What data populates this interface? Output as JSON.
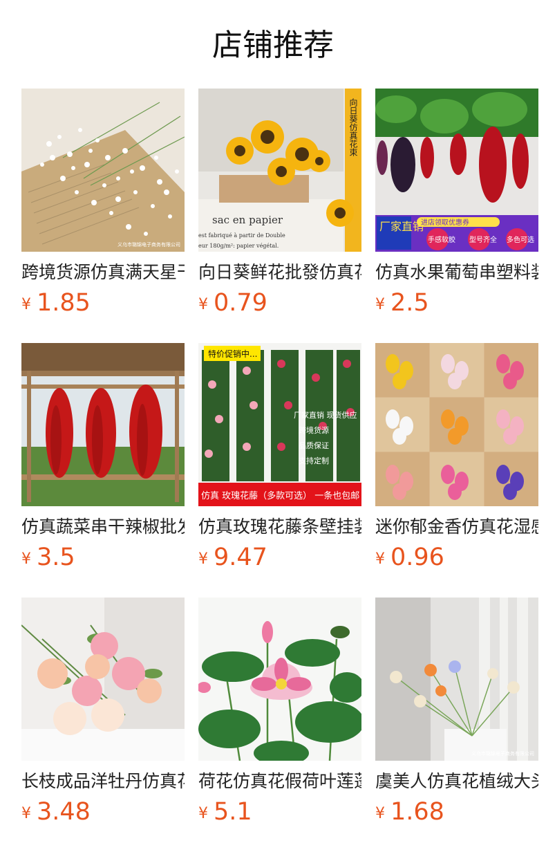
{
  "header": {
    "title": "店铺推荐"
  },
  "products": [
    {
      "name": "跨境货源仿真满天星干花批发",
      "currency": "¥",
      "price": "1.85",
      "watermark": "义乌市璐锦电子商务有限公司"
    },
    {
      "name": "向日葵鲜花批發仿真花束",
      "currency": "¥",
      "price": "0.79",
      "overlay": {
        "vertical": "向日葵仿真花束",
        "paper_line1": "sac en papier",
        "paper_line2": "est fabriqué à partir de Double",
        "paper_line3": "eur 180g/m²: papier végétal."
      }
    },
    {
      "name": "仿真水果葡萄串塑料装饰",
      "currency": "¥",
      "price": "2.5",
      "overlay": {
        "badge": "厂家直销",
        "coupon": "进店领取优惠券",
        "tag1": "手感软胶",
        "tag2": "型号齐全",
        "tag3": "多色可选"
      }
    },
    {
      "name": "仿真蔬菜串干辣椒批发装饰",
      "currency": "¥",
      "price": "3.5"
    },
    {
      "name": "仿真玫瑰花藤条壁挂装饰",
      "currency": "¥",
      "price": "9.47",
      "overlay": {
        "promo": "特价促销中...",
        "l1": "厂家直销 现货供应",
        "l2": "跨境货源",
        "l3": "品质保证",
        "l4": "支持定制",
        "bottom": "仿真 玫瑰花藤（多款可选） 一条也包邮"
      }
    },
    {
      "name": "迷你郁金香仿真花湿感",
      "currency": "¥",
      "price": "0.96"
    },
    {
      "name": "长枝成品洋牡丹仿真花",
      "currency": "¥",
      "price": "3.48"
    },
    {
      "name": "荷花仿真花假荷叶莲蓬",
      "currency": "¥",
      "price": "5.1"
    },
    {
      "name": "虞美人仿真花植绒大头",
      "currency": "¥",
      "price": "1.68",
      "watermark": "义乌市璐锦电子商务有限公司"
    }
  ],
  "colors": {
    "price": "#e8541e",
    "title": "#111111"
  }
}
